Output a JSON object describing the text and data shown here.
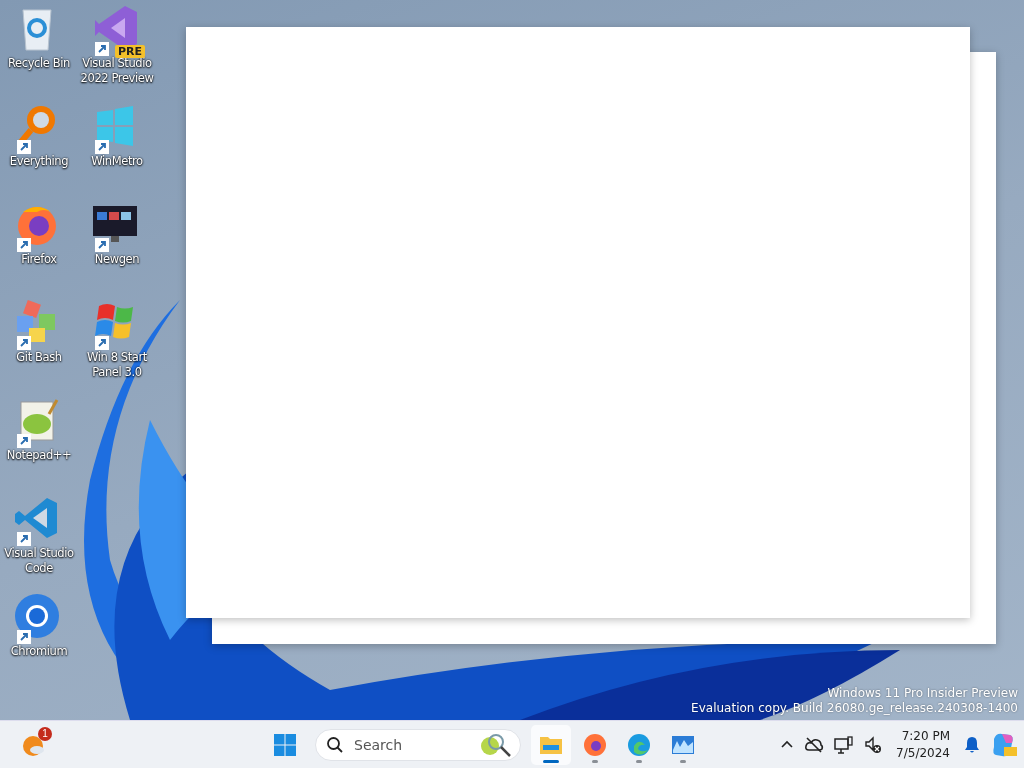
{
  "desktop": {
    "columns": [
      [
        {
          "label": "Recycle Bin",
          "kind": "recycle",
          "shortcut": false
        },
        {
          "label": "Everything",
          "kind": "everything",
          "shortcut": true
        },
        {
          "label": "Firefox",
          "kind": "firefox",
          "shortcut": true
        },
        {
          "label": "Git Bash",
          "kind": "git",
          "shortcut": true
        },
        {
          "label": "Notepad++",
          "kind": "notepad",
          "shortcut": true
        },
        {
          "label": "Visual Studio Code",
          "kind": "vscode",
          "shortcut": true
        },
        {
          "label": "Chromium",
          "kind": "chromium",
          "shortcut": true
        }
      ],
      [
        {
          "label": "Visual Studio 2022 Preview",
          "kind": "vstudio",
          "shortcut": true,
          "badge": "PRE"
        },
        {
          "label": "WinMetro",
          "kind": "metro",
          "shortcut": true
        },
        {
          "label": "Newgen",
          "kind": "newgen",
          "shortcut": true
        },
        {
          "label": "Win 8 Start Panel 3.0",
          "kind": "winflag",
          "shortcut": true
        }
      ]
    ]
  },
  "watermark": [
    "Windows 11 Pro Insider Preview",
    "Evaluation copy. Build 26080.ge_release.240308-1400"
  ],
  "taskbar": {
    "widgets_badge": "1",
    "search": {
      "placeholder": "Search"
    },
    "apps": [
      {
        "kind": "explorer",
        "running": true,
        "selected": true
      },
      {
        "kind": "firefox",
        "running": true,
        "selected": false
      },
      {
        "kind": "edge",
        "running": true,
        "selected": false
      },
      {
        "kind": "monitor",
        "running": true,
        "selected": false
      }
    ],
    "clock": {
      "time": "7:20 PM",
      "date": "7/5/2024"
    }
  }
}
